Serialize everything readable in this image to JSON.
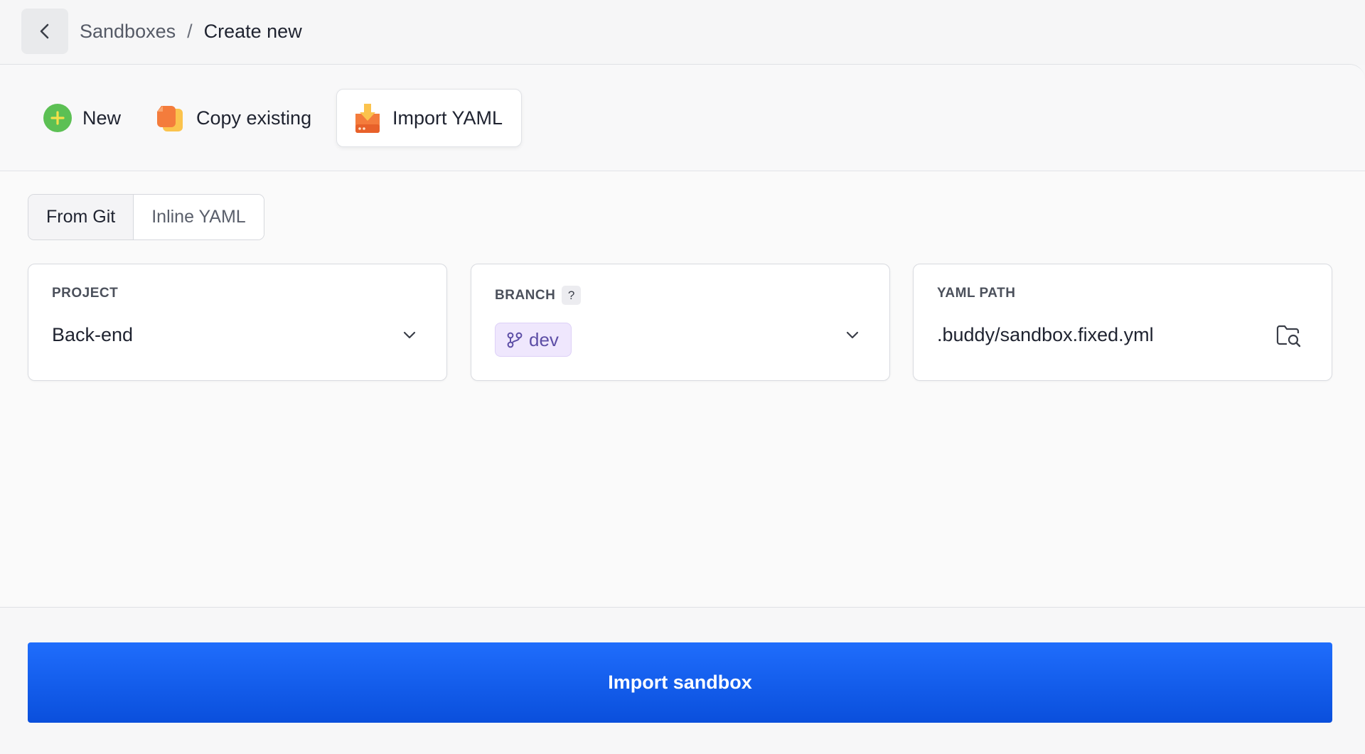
{
  "breadcrumb": {
    "parent": "Sandboxes",
    "separator": "/",
    "current": "Create new"
  },
  "create_types": [
    {
      "label": "New",
      "icon": "plus-circle-icon",
      "active": false
    },
    {
      "label": "Copy existing",
      "icon": "copy-icon",
      "active": false
    },
    {
      "label": "Import YAML",
      "icon": "import-icon",
      "active": true
    }
  ],
  "source_tabs": [
    {
      "label": "From Git",
      "active": true
    },
    {
      "label": "Inline YAML",
      "active": false
    }
  ],
  "fields": {
    "project": {
      "label": "PROJECT",
      "value": "Back-end"
    },
    "branch": {
      "label": "BRANCH",
      "help": "?",
      "value": "dev"
    },
    "yaml_path": {
      "label": "YAML PATH",
      "value": ".buddy/sandbox.fixed.yml"
    }
  },
  "submit": {
    "label": "Import sandbox"
  },
  "colors": {
    "primary": "#1a62f0",
    "branch_pill": "#efe7fd",
    "new_icon": "#5cc054",
    "copy_icon": "#f47c3c"
  }
}
